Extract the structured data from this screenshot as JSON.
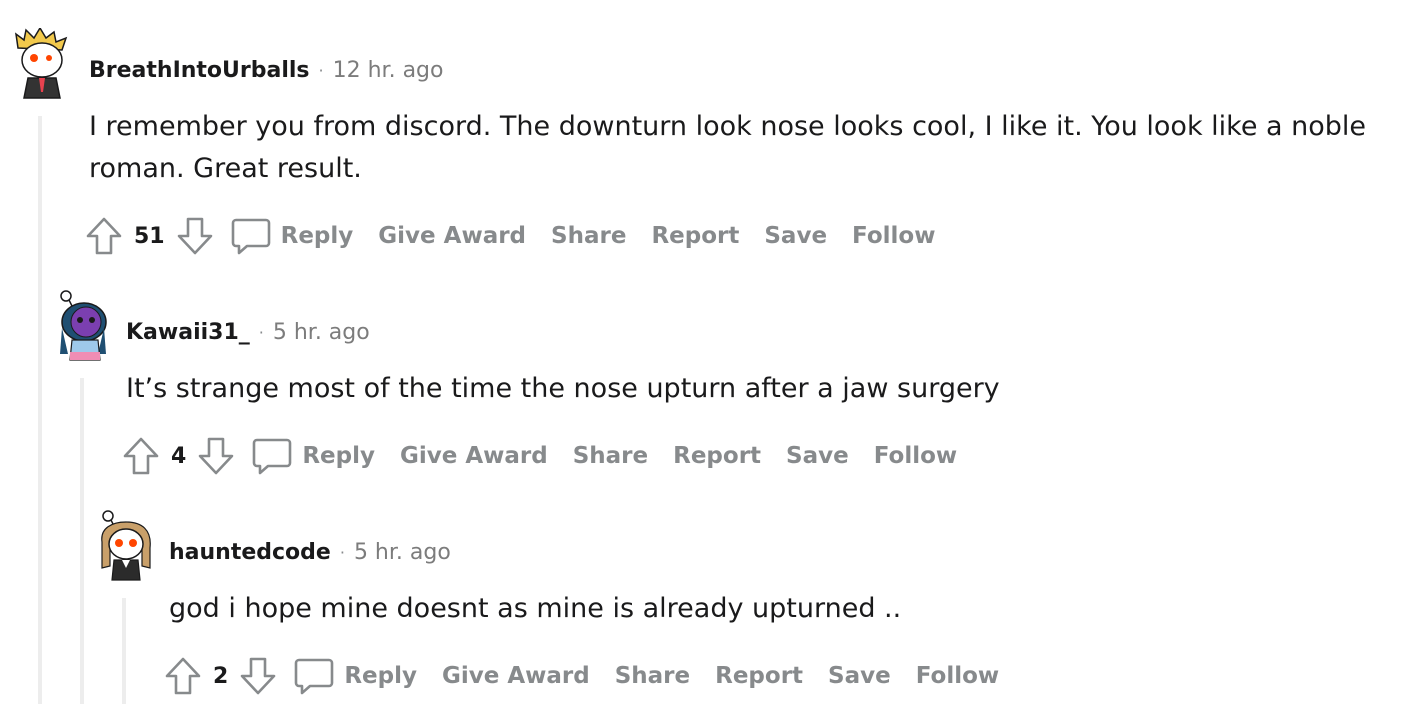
{
  "comments": [
    {
      "username": "BreathIntoUrballs",
      "separator": "·",
      "time": "12 hr. ago",
      "body": "I remember you from discord. The downturn look nose looks cool, I like it. You look like a noble roman. Great result.",
      "score": "51",
      "avatar_icon": "snoo-avatar-blond-hair-icon"
    },
    {
      "username": "Kawaii31_",
      "separator": "·",
      "time": "5 hr. ago",
      "body": "It’s strange most of the time the nose upturn after a jaw surgery",
      "score": "4",
      "avatar_icon": "snoo-avatar-purple-alien-icon"
    },
    {
      "username": "hauntedcode",
      "separator": "·",
      "time": "5 hr. ago",
      "body": "god i hope mine doesnt as mine is already upturned ..",
      "score": "2",
      "avatar_icon": "snoo-avatar-brown-hair-icon"
    }
  ],
  "actions": {
    "reply": "Reply",
    "give_award": "Give Award",
    "share": "Share",
    "report": "Report",
    "save": "Save",
    "follow": "Follow"
  },
  "colors": {
    "text": "#1a1a1b",
    "muted": "#878a8c",
    "thread_line": "#ededed"
  }
}
